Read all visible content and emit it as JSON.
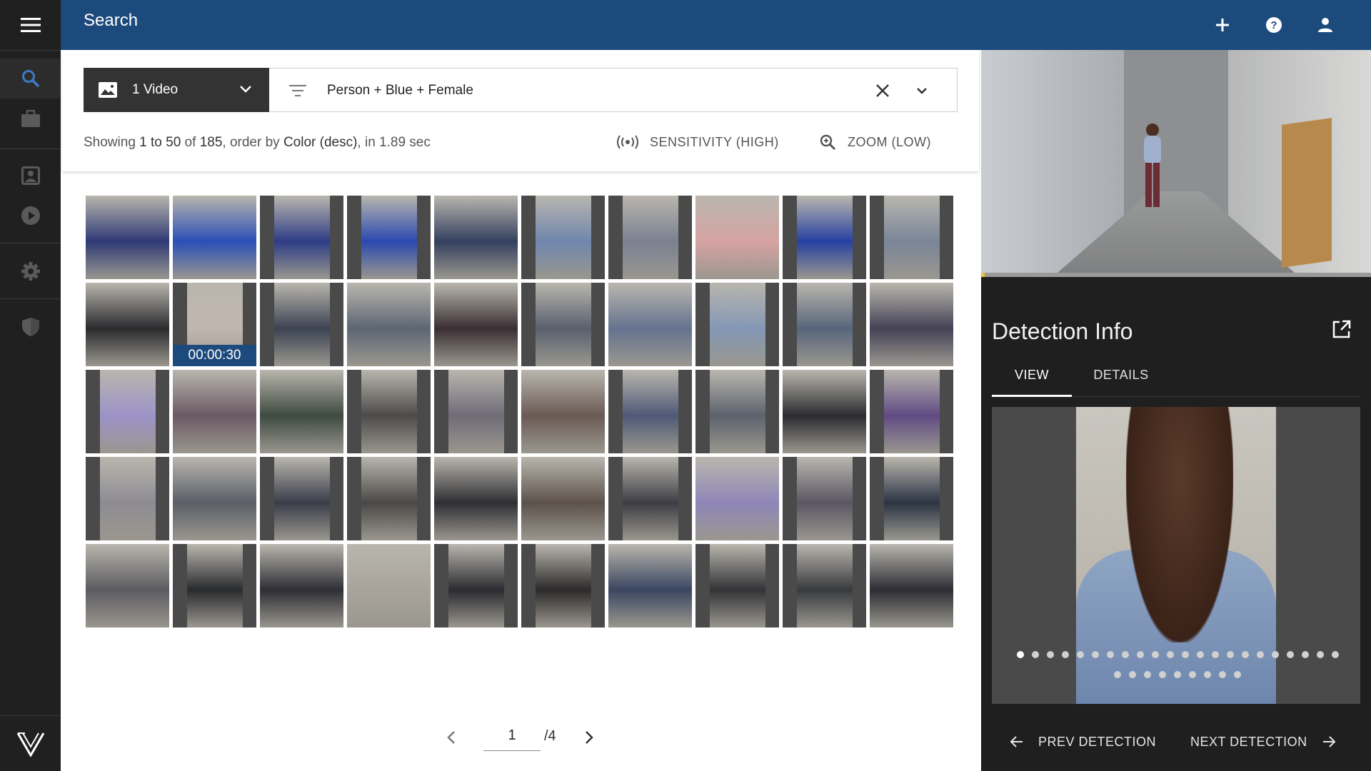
{
  "app": {
    "title": "Search"
  },
  "rail": {
    "items": [
      "menu-icon",
      "search-icon",
      "briefcase-icon",
      "contact-card-icon",
      "play-icon",
      "gear-icon",
      "shield-icon",
      "logo-mark"
    ]
  },
  "header": {
    "icons": [
      "plus-icon",
      "help-icon",
      "account-icon"
    ]
  },
  "search": {
    "video_selector": "1 Video",
    "query": "Person + Blue + Female",
    "status_prefix": "Showing ",
    "status_range": "1 to 50",
    "status_of": " of ",
    "status_total": "185",
    "status_order": ", order by ",
    "status_order_field": "Color (desc)",
    "status_time": ", in 1.89 sec",
    "sensitivity": "SENSITIVITY (HIGH)",
    "zoom": "ZOOM (LOW)"
  },
  "grid": {
    "timestamp": "00:00:30",
    "colors": [
      "#2f3a76",
      "#2a4fb6",
      "#2e3d86",
      "#2b49b0",
      "#34405e",
      "#6f86ad",
      "#7b8192",
      "#d6a3a2",
      "#2741a0",
      "#7a8598",
      "#2b2b2e",
      "#c0b6b0",
      "#3c4352",
      "#5e6674",
      "#3a2f32",
      "#59606e",
      "#65738f",
      "#8397b4",
      "#57657b",
      "#454257",
      "#9d93c8",
      "#6b5a65",
      "#3e4a40",
      "#4e4a4a",
      "#6f6c78",
      "#6a5a54",
      "#4f5a77",
      "#5c626d",
      "#2c2c30",
      "#604b84",
      "#8e8c92",
      "#5a5e66",
      "#3a3d4a",
      "#4b4846",
      "#2f2f33",
      "#5c514b",
      "#3d3d44",
      "#8f86b8",
      "#5a5664",
      "#2c3443",
      "#5c5b60",
      "#2a2b2e",
      "#2e2e34",
      "#a8a49c",
      "#2b2b30",
      "#2c2a2a",
      "#3a4660",
      "#343437",
      "#383a3e",
      "#2d2d34"
    ]
  },
  "pagination": {
    "current": "1",
    "total": "/4"
  },
  "detection": {
    "title": "Detection Info",
    "tabs": [
      "VIEW",
      "DETAILS"
    ],
    "dots_row1": 22,
    "dots_row2": 9,
    "active_dot": 0,
    "preview_progress": 0.01,
    "prev": "PREV DETECTION",
    "next": "NEXT DETECTION"
  }
}
